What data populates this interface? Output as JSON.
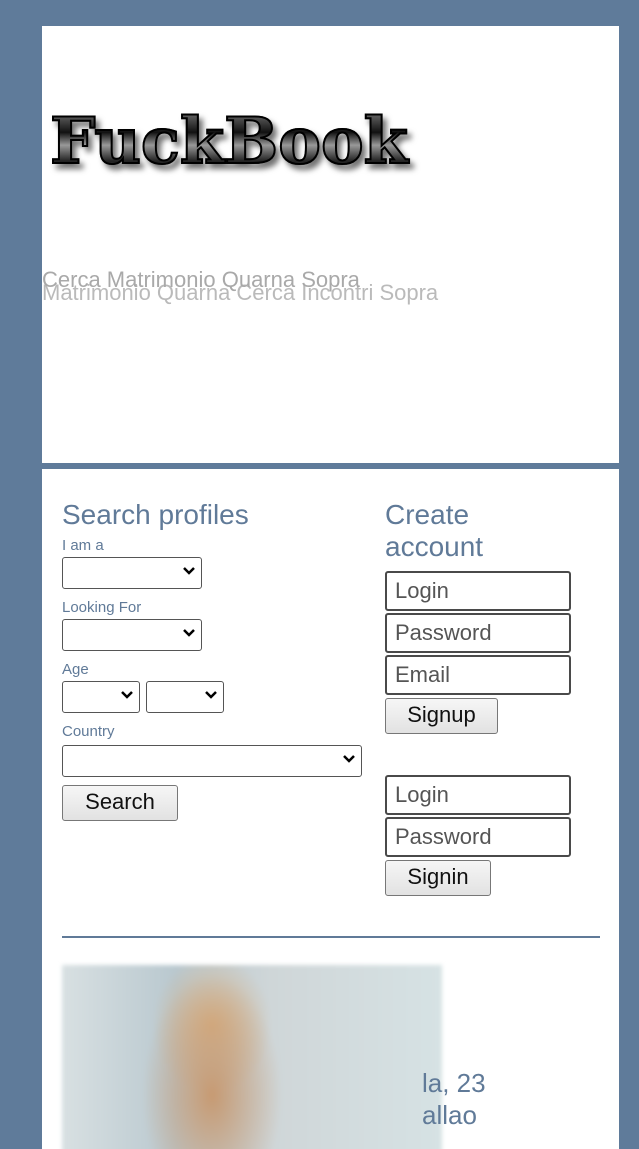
{
  "header": {
    "logo_text": "FuckBook",
    "tagline_1": "Cerca Matrimonio Quarna Sopra",
    "tagline_2": "Matrimonio Quarna Cerca Incontri Sopra"
  },
  "search": {
    "title": "Search profiles",
    "i_am_label": "I am a",
    "looking_for_label": "Looking For",
    "age_label": "Age",
    "country_label": "Country",
    "search_button": "Search"
  },
  "account": {
    "title_line1": "Create",
    "title_line2": "account",
    "login_placeholder": "Login",
    "password_placeholder": "Password",
    "email_placeholder": "Email",
    "signup_button": "Signup",
    "signin_login_placeholder": "Login",
    "signin_password_placeholder": "Password",
    "signin_button": "Signin"
  },
  "profile": {
    "caption_line1": "la, 23",
    "caption_line2": "allao"
  },
  "colors": {
    "background": "#5f7b9a",
    "accent": "#607a98"
  }
}
